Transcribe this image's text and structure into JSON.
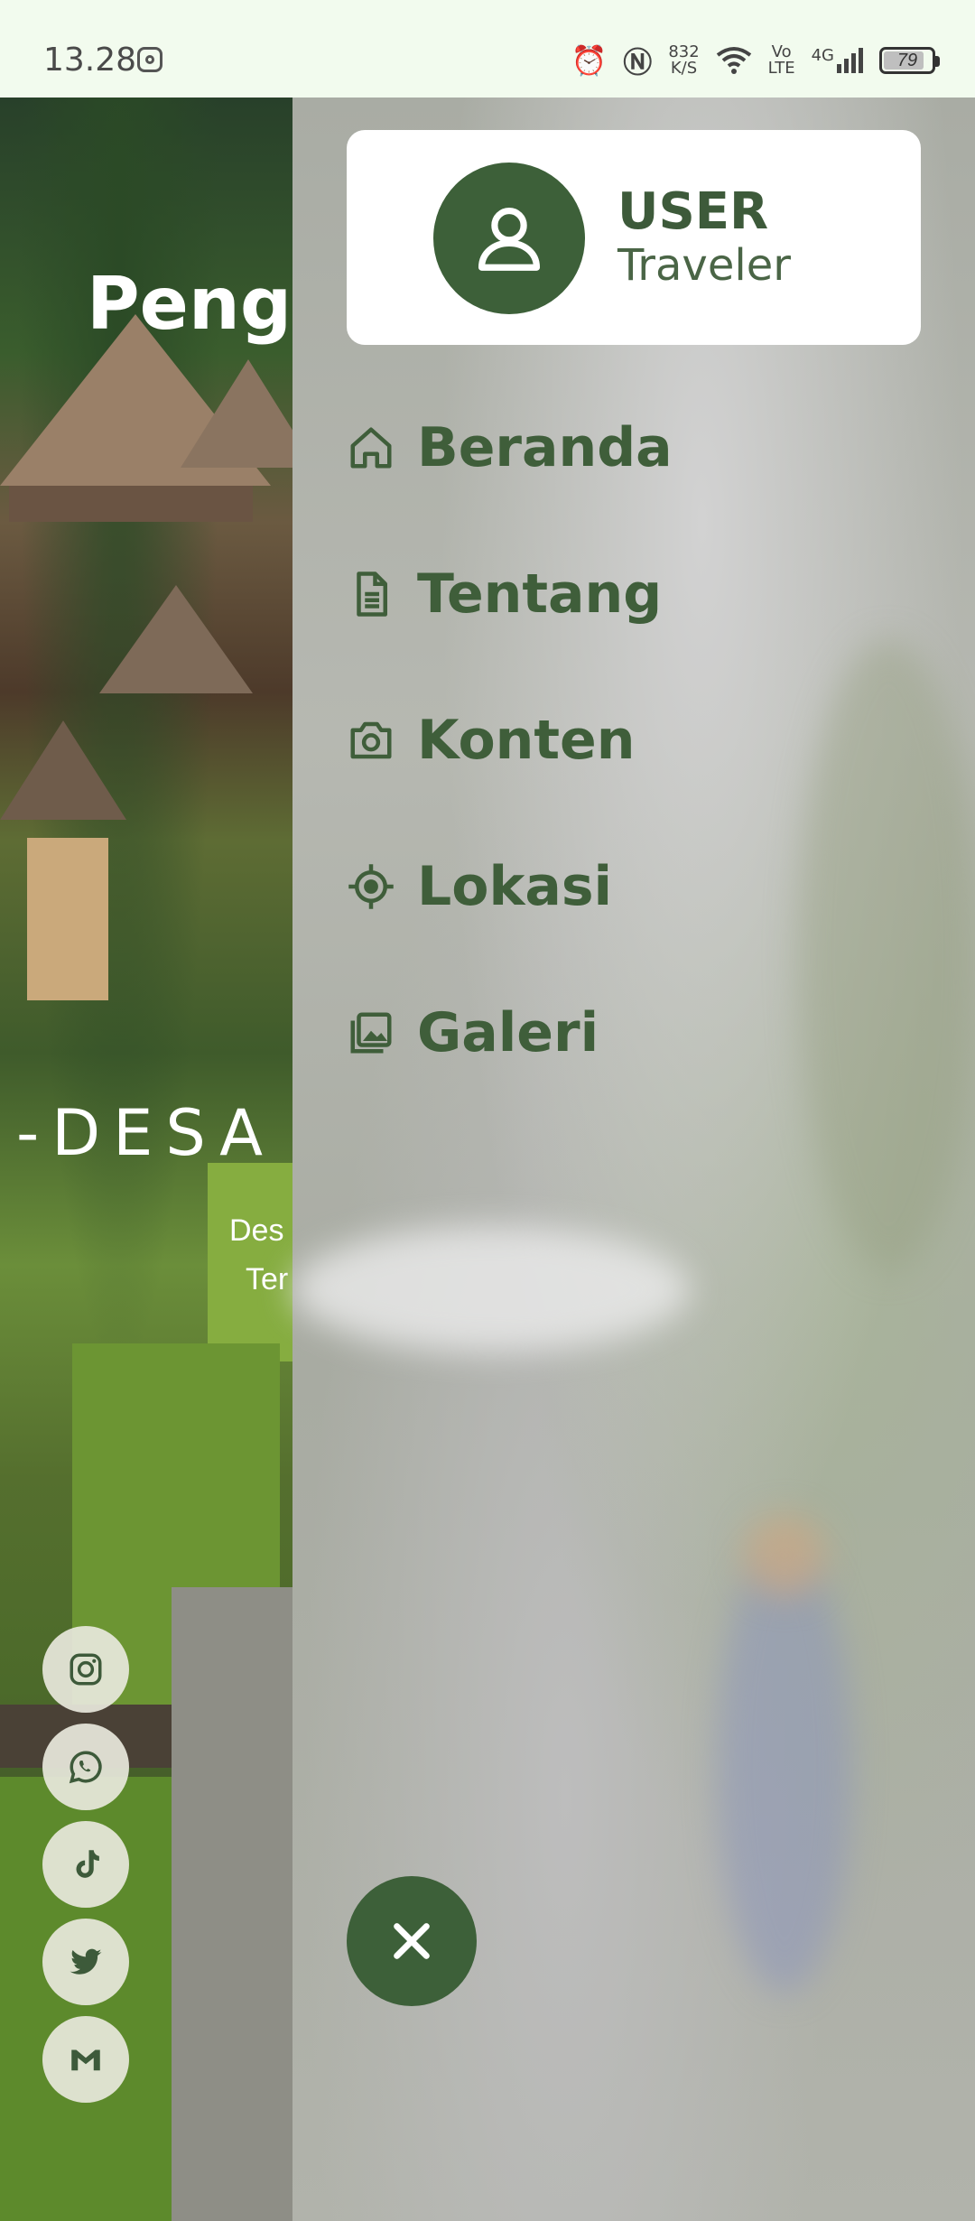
{
  "status_bar": {
    "time": "13.28",
    "speed": "832",
    "speed_unit": "K/S",
    "volte_top": "Vo",
    "volte_bottom": "LTE",
    "network": "4G",
    "battery": "79",
    "battery_level": 0.79
  },
  "hero": {
    "title": "Pengh",
    "subtitle": "-DESA",
    "desc_line1": "Des",
    "desc_line2": "Ter"
  },
  "social": [
    {
      "icon": "instagram-icon"
    },
    {
      "icon": "whatsapp-icon"
    },
    {
      "icon": "tiktok-icon"
    },
    {
      "icon": "twitter-icon"
    },
    {
      "icon": "gmail-icon"
    }
  ],
  "drawer": {
    "user": {
      "name": "USER",
      "role": "Traveler"
    },
    "menu": [
      {
        "label": "Beranda",
        "icon": "home-icon"
      },
      {
        "label": "Tentang",
        "icon": "document-icon"
      },
      {
        "label": "Konten",
        "icon": "camera-icon"
      },
      {
        "label": "Lokasi",
        "icon": "location-target-icon"
      },
      {
        "label": "Galeri",
        "icon": "gallery-icon"
      }
    ]
  },
  "colors": {
    "accent": "#3d6039",
    "menu_text": "#3f5e3a",
    "status_bar_bg": "#f2fbee"
  }
}
